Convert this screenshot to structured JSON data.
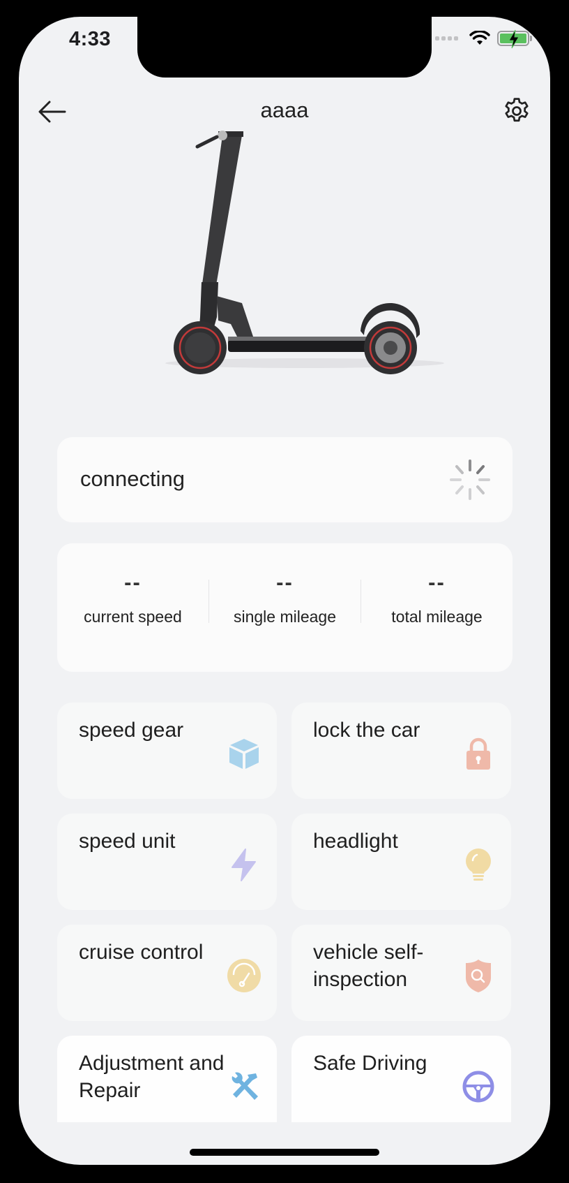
{
  "status_bar": {
    "time": "4:33",
    "wifi_icon": "wifi-icon",
    "battery_icon": "battery-charging-icon",
    "battery_color": "#5ac05e"
  },
  "header": {
    "back_icon": "arrow-left-icon",
    "title": "aaaa",
    "settings_icon": "gear-icon"
  },
  "hero": {
    "image": "electric-scooter-image"
  },
  "connection": {
    "status": "connecting",
    "icon": "loading-spinner-icon"
  },
  "stats": [
    {
      "value": "--",
      "label": "current speed"
    },
    {
      "value": "--",
      "label": "single mileage"
    },
    {
      "value": "--",
      "label": "total mileage"
    }
  ],
  "features": [
    {
      "label": "speed gear",
      "icon": "cube-icon",
      "color": "#a9d3ec"
    },
    {
      "label": "lock the car",
      "icon": "lock-icon",
      "color": "#efb9a9"
    },
    {
      "label": "speed unit",
      "icon": "lightning-icon",
      "color": "#c5c2ee"
    },
    {
      "label": "headlight",
      "icon": "lightbulb-icon",
      "color": "#f1dba4"
    },
    {
      "label": "cruise control",
      "icon": "speedometer-icon",
      "color": "#f0dba6"
    },
    {
      "label": "vehicle self-inspection",
      "icon": "shield-search-icon",
      "color": "#efb9a9"
    },
    {
      "label": "Adjustment and Repair",
      "icon": "tools-icon",
      "color": "#6fb3e0"
    },
    {
      "label": "Safe Driving",
      "icon": "steering-wheel-icon",
      "color": "#8e8ee6"
    }
  ]
}
